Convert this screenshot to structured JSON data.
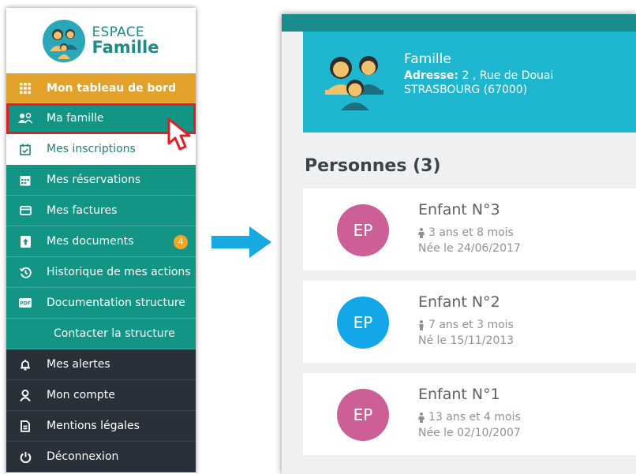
{
  "sidebar": {
    "brand": {
      "line1": "ESPACE",
      "line2": "Famille",
      "icon": "family-logo-icon"
    },
    "items": [
      {
        "label": "Mon tableau de bord",
        "icon": "grid-icon",
        "style": "dashboard"
      },
      {
        "label": "Ma famille",
        "icon": "family-icon",
        "style": "green",
        "selected": true
      },
      {
        "label": "Mes inscriptions",
        "icon": "calendar-check-icon",
        "style": "white"
      },
      {
        "label": "Mes réservations",
        "icon": "calendar-icon",
        "style": "green"
      },
      {
        "label": "Mes factures",
        "icon": "card-icon",
        "style": "green"
      },
      {
        "label": "Mes documents",
        "icon": "document-upload-icon",
        "style": "green",
        "badge": "4"
      },
      {
        "label": "Historique de mes actions",
        "icon": "history-icon",
        "style": "green"
      },
      {
        "label": "Documentation structure",
        "icon": "pdf-icon",
        "style": "green"
      },
      {
        "label": "Contacter la structure",
        "icon": "",
        "style": "green"
      },
      {
        "label": "Mes alertes",
        "icon": "bell-icon",
        "style": "dark"
      },
      {
        "label": "Mon compte",
        "icon": "user-icon",
        "style": "dark"
      },
      {
        "label": "Mentions légales",
        "icon": "file-text-icon",
        "style": "dark"
      },
      {
        "label": "Déconnexion",
        "icon": "power-icon",
        "style": "dark"
      }
    ]
  },
  "family": {
    "title": "Famille",
    "address_label": "Adresse:",
    "address_line1": " 2 , Rue de Douai",
    "address_line2": "STRASBOURG (67000)"
  },
  "persons": {
    "title": "Personnes (3)",
    "list": [
      {
        "initials": "EP",
        "name": "Enfant N°3",
        "age": "3 ans et 8 mois",
        "born": "Née le 24/06/2017",
        "color": "#cc5f95"
      },
      {
        "initials": "EP",
        "name": "Enfant N°2",
        "age": "7 ans et 3 mois",
        "born": "Né le 15/11/2013",
        "color": "#13a7ea"
      },
      {
        "initials": "EP",
        "name": "Enfant N°1",
        "age": "13 ans et 4 mois",
        "born": "Née le 02/10/2007",
        "color": "#cc5f95"
      }
    ]
  },
  "colors": {
    "accent": "#139585",
    "dashboard": "#e2a12b",
    "dark": "#283039",
    "family_card": "#1fb6cf",
    "highlight": "#e21d23",
    "arrow": "#19a9e1"
  }
}
